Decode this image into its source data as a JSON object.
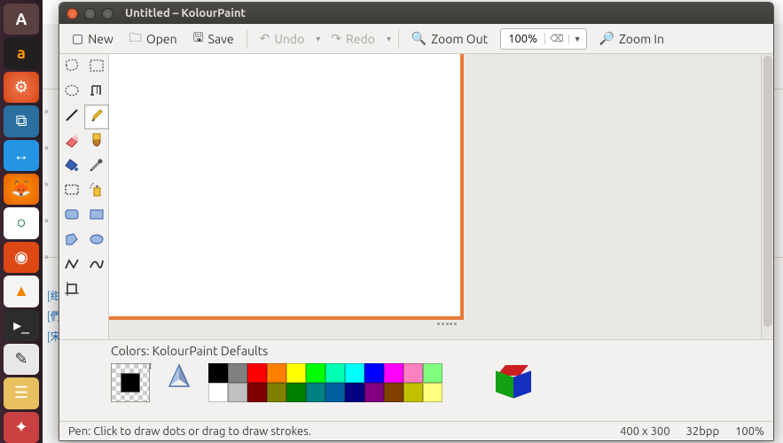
{
  "window": {
    "title": "Untitled – KolourPaint"
  },
  "toolbar": {
    "new": "New",
    "open": "Open",
    "save": "Save",
    "undo": "Undo",
    "redo": "Redo",
    "zoom_out": "Zoom Out",
    "zoom_in": "Zoom In",
    "zoom_value": "100%"
  },
  "tools": [
    {
      "name": "free-select"
    },
    {
      "name": "rect-select"
    },
    {
      "name": "ellipse-select"
    },
    {
      "name": "text"
    },
    {
      "name": "line"
    },
    {
      "name": "pen",
      "selected": true
    },
    {
      "name": "eraser"
    },
    {
      "name": "brush"
    },
    {
      "name": "fill"
    },
    {
      "name": "color-picker"
    },
    {
      "name": "rect-dashed"
    },
    {
      "name": "spray"
    },
    {
      "name": "rounded-rect"
    },
    {
      "name": "rectangle"
    },
    {
      "name": "polygon"
    },
    {
      "name": "ellipse"
    },
    {
      "name": "connected-lines"
    },
    {
      "name": "curve"
    },
    {
      "name": "crop"
    }
  ],
  "colorbar": {
    "label": "Colors: KolourPaint Defaults",
    "foreground": "#000000",
    "background": "transparent",
    "palette_row1": [
      "#000000",
      "#808080",
      "#ff0000",
      "#ff8000",
      "#ffff00",
      "#00ff00",
      "#00ffb0",
      "#00ffff",
      "#0000ff",
      "#ff00ff",
      "#ff80c0",
      "#80ff80"
    ],
    "palette_row2": [
      "#ffffff",
      "#c0c0c0",
      "#800000",
      "#808000",
      "#008000",
      "#008080",
      "#0060a0",
      "#000080",
      "#800080",
      "#804000",
      "#c0c000",
      "#ffff80"
    ]
  },
  "status": {
    "hint": "Pen: Click to draw dots or drag to draw strokes.",
    "dims": "400 x 300",
    "depth": "32bpp",
    "zoom": "100%"
  }
}
